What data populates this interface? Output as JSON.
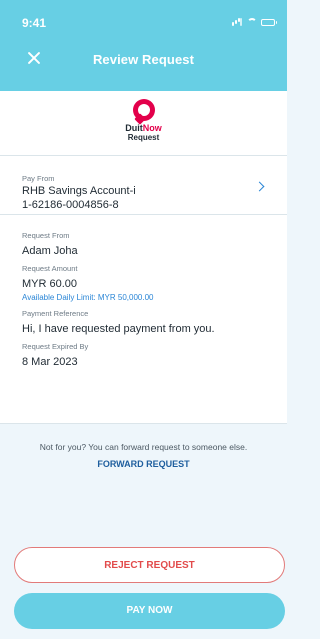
{
  "status_bar": {
    "time": "9:41"
  },
  "header": {
    "title": "Review Request"
  },
  "logo": {
    "title_part1": "Duit",
    "title_part2": "Now",
    "subtitle": "Request"
  },
  "pay_from": {
    "label": "Pay From",
    "account_name": "RHB Savings Account-i",
    "account_number": "1-62186-0004856-8"
  },
  "request_details": {
    "request_from_label": "Request From",
    "request_from_value": "Adam Joha",
    "request_amount_label": "Request Amount",
    "request_amount_value": "MYR 60.00",
    "daily_limit_text": "Available Daily Limit: MYR 50,000.00",
    "payment_reference_label": "Payment Reference",
    "payment_reference_value": "Hi, I have requested payment from you.",
    "request_expiry_label": "Request Expired By",
    "request_expiry_value": "8 Mar 2023"
  },
  "forward": {
    "text": "Not for you? You can forward request to someone else.",
    "action_label": "FORWARD REQUEST"
  },
  "actions": {
    "reject_label": "REJECT REQUEST",
    "pay_label": "PAY NOW"
  },
  "colors": {
    "primary": "#67cfe4",
    "accent_red": "#e24b4b",
    "link_blue": "#1e5e9e",
    "background": "#eef6fb"
  },
  "icons": {
    "close": "close-icon",
    "chevron": "chevron-right-icon",
    "signal": "signal-icon",
    "wifi": "wifi-icon",
    "battery": "battery-icon",
    "logo": "duitnow-icon"
  }
}
